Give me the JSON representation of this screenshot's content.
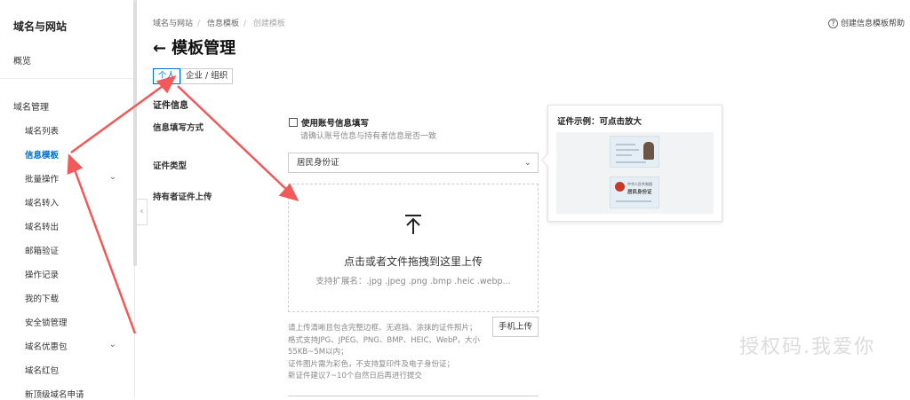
{
  "sidebar": {
    "title": "域名与网站",
    "overview": "概览",
    "group": "域名管理",
    "items": [
      {
        "label": "域名列表",
        "active": false,
        "expandable": false
      },
      {
        "label": "信息模板",
        "active": true,
        "expandable": false
      },
      {
        "label": "批量操作",
        "active": false,
        "expandable": true
      },
      {
        "label": "域名转入",
        "active": false,
        "expandable": false
      },
      {
        "label": "域名转出",
        "active": false,
        "expandable": false
      },
      {
        "label": "邮箱验证",
        "active": false,
        "expandable": false
      },
      {
        "label": "操作记录",
        "active": false,
        "expandable": false
      },
      {
        "label": "我的下载",
        "active": false,
        "expandable": false
      },
      {
        "label": "安全锁管理",
        "active": false,
        "expandable": false
      },
      {
        "label": "域名优惠包",
        "active": false,
        "expandable": true
      },
      {
        "label": "域名红包",
        "active": false,
        "expandable": false
      },
      {
        "label": "新顶级域名申请",
        "active": false,
        "expandable": false
      }
    ]
  },
  "breadcrumb": [
    "域名与网站",
    "信息模板",
    "创建模板"
  ],
  "help_link": "创建信息模板帮助",
  "page_title": "模板管理",
  "tabs": [
    {
      "label": "个人",
      "active": true
    },
    {
      "label": "企业 / 组织",
      "active": false
    }
  ],
  "form": {
    "section_title": "证件信息",
    "fill_method_label": "信息填写方式",
    "checkbox_label": "使用账号信息填写",
    "checkbox_hint": "请确认账号信息与持有者信息是否一致",
    "cert_type_label": "证件类型",
    "cert_type_value": "居民身份证",
    "upload_label": "持有者证件上传",
    "upload_main": "点击或者文件拖拽到这里上传",
    "upload_formats": "支持扩展名：.jpg .jpeg .png .bmp .heic .webp...",
    "upload_notes": [
      "请上传清晰且包含完整边框、无遮挡、涂抹的证件照片；",
      "格式支持JPG、JPEG、PNG、BMP、HEIC、WebP，大小",
      "55KB~5M以内；",
      "证件图片需为彩色，不支持复印件及电子身份证；",
      "新证件建议7~10个自然日后再进行提交"
    ],
    "mobile_upload_button": "手机上传"
  },
  "example_panel": {
    "title": "证件示例：可点击放大",
    "back_card_text": [
      "中华人民共和国",
      "居民身份证"
    ]
  },
  "watermark": "授权码.我爱你",
  "colors": {
    "accent": "#0070cc",
    "arrow": "#f05a5a"
  },
  "icons": {
    "back": "arrow-left-icon",
    "upload": "upload-arrow-icon",
    "help": "question-circle-icon",
    "chevron": "chevron-down-icon",
    "collapse": "chevron-left-icon"
  }
}
